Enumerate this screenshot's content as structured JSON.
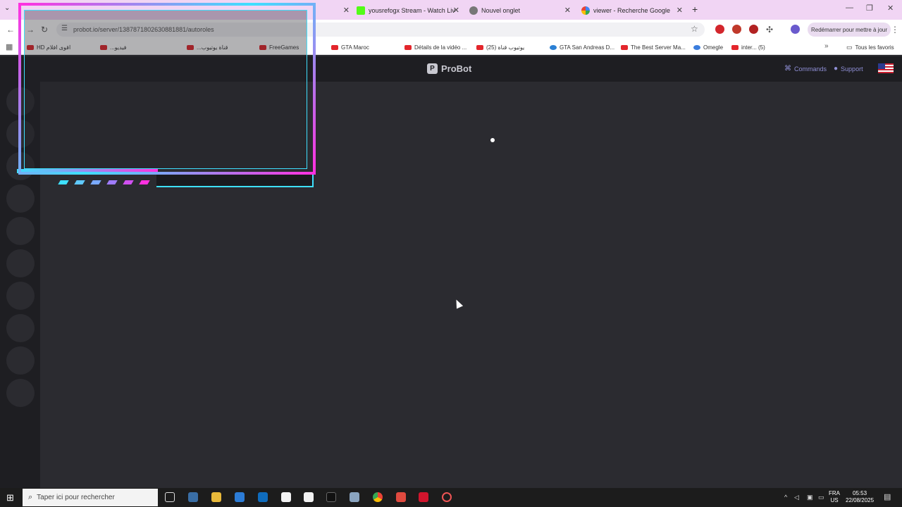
{
  "browser": {
    "tabs": [
      {
        "label": "",
        "active": false
      },
      {
        "label": "yousrefogx Stream - Watch Liv",
        "favicon": "kick-icon"
      },
      {
        "label": "Nouvel onglet",
        "favicon": "chrome-icon"
      },
      {
        "label": "viewer - Recherche Google",
        "favicon": "google-icon"
      }
    ],
    "new_tab_label": "+",
    "url": "probot.io/server/1387871802630881881/autoroles",
    "reload_prompt": "Redémarrer pour mettre à jour",
    "bookmarks": [
      "HD اقوى افلام",
      "...فيديو",
      "...قناة يوتيوب",
      "FreeGames",
      "GTA Maroc",
      "Détails de la vidéo ...",
      "يوتيوب قناة (25)",
      "GTA San Andreas D...",
      "The Best Server Ma...",
      "Omegle",
      "inter... (5)"
    ],
    "all_bookmarks_label": "Tous les favoris"
  },
  "probot": {
    "brand": "ProBot",
    "nav": {
      "commands": "Commands",
      "support": "Support"
    }
  },
  "taskbar": {
    "search_placeholder": "Taper ici pour rechercher",
    "language_line1": "FRA",
    "language_line2": "US",
    "time": "05:53",
    "date": "22/08/2025"
  },
  "colors": {
    "overlay_pink": "#ff30e0",
    "overlay_cyan": "#3ee0ff",
    "page_bg": "#2b2b30",
    "sidebar_bg": "#1e1e22",
    "nav_link": "#8f8fd6"
  }
}
